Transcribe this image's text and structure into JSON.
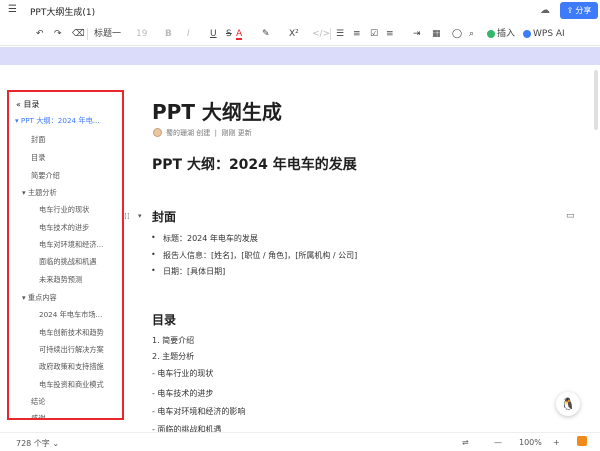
{
  "app": {
    "title": "PPT大纲生成(1)",
    "share_label": "分享"
  },
  "toolbar": {
    "undo": "↶",
    "redo": "↷",
    "format_painter": "⌫",
    "style": "标题一",
    "font_size": "19",
    "bold": "B",
    "italic": "I",
    "underline": "U",
    "strike": "S",
    "color": "A",
    "highlight": "✎",
    "superscript": "X²",
    "code": "</>",
    "insert_label": "插入",
    "wps_ai_label": "WPS AI"
  },
  "sidebar": {
    "header": "目录",
    "items": [
      {
        "label": "▾ PPT 大纲：2024 年电...",
        "active": true
      },
      {
        "label": "封面"
      },
      {
        "label": "目录"
      },
      {
        "label": "简要介绍"
      },
      {
        "label": "▾ 主题分析"
      },
      {
        "label": "电车行业的现状"
      },
      {
        "label": "电车技术的进步"
      },
      {
        "label": "电车对环境和经济..."
      },
      {
        "label": "面临的挑战和机遇"
      },
      {
        "label": "未来趋势预测"
      },
      {
        "label": "▾ 重点内容"
      },
      {
        "label": "2024 年电车市场..."
      },
      {
        "label": "电车创新技术和趋势"
      },
      {
        "label": "可持续出行解决方案"
      },
      {
        "label": "政府政策和支持措施"
      },
      {
        "label": "电车投资和商业模式"
      },
      {
        "label": "结论"
      },
      {
        "label": "感谢"
      }
    ]
  },
  "doc": {
    "title": "PPT 大纲生成",
    "author_name": "蜀的珊湖",
    "author_action": "创建",
    "updated": "刚刚 更新",
    "h1": "PPT 大纲：2024 年电车的发展",
    "cover_heading": "封面",
    "cover_items": [
      "标题：2024 年电车的发展",
      "报告人信息：[姓名]，[职位 / 角色]，[所属机构 / 公司]",
      "日期：[具体日期]"
    ],
    "toc_heading": "目录",
    "toc_items": [
      "1.  简要介绍",
      "2.  主题分析",
      "- 电车行业的现状",
      "- 电车技术的进步",
      "- 电车对环境和经济的影响",
      "- 面临的挑战和机遇"
    ]
  },
  "status": {
    "word_count": "728 个字 ⌄",
    "zoom": "100%",
    "minus": "—",
    "plus": "+"
  },
  "colors": {
    "accent": "#3e7bfa",
    "highlight_border": "#e8262b",
    "banner": "#dadcfa"
  }
}
